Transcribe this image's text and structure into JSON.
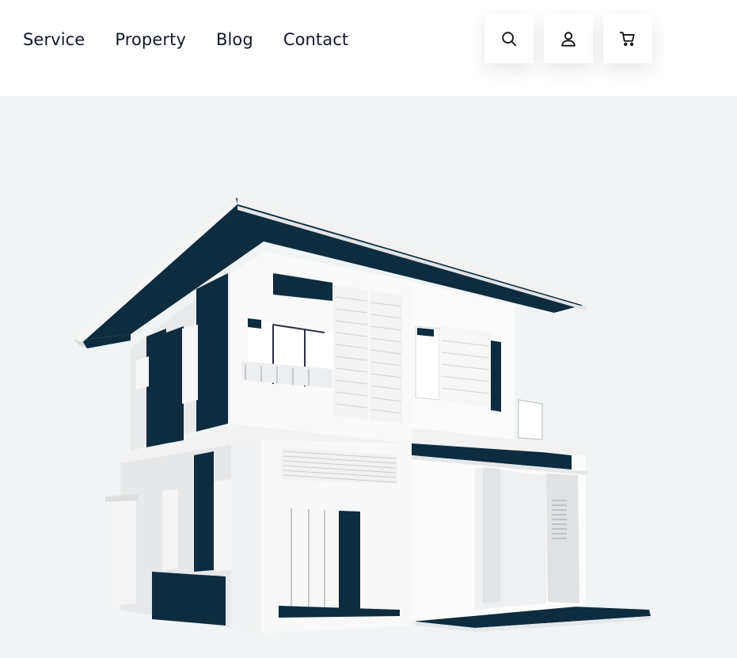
{
  "nav": {
    "items": [
      {
        "label": "Service"
      },
      {
        "label": "Property"
      },
      {
        "label": "Blog"
      },
      {
        "label": "Contact"
      }
    ]
  },
  "header_actions": [
    {
      "icon": "search-icon"
    },
    {
      "icon": "user-icon"
    },
    {
      "icon": "cart-icon"
    }
  ],
  "hero": {
    "image": "modern two-story house 3D render",
    "colors": {
      "background": "#f0f4f5",
      "dark_accent": "#0d2c3f",
      "wall": "#f7f7f7",
      "wall_shadow": "#dfe1e3"
    }
  }
}
